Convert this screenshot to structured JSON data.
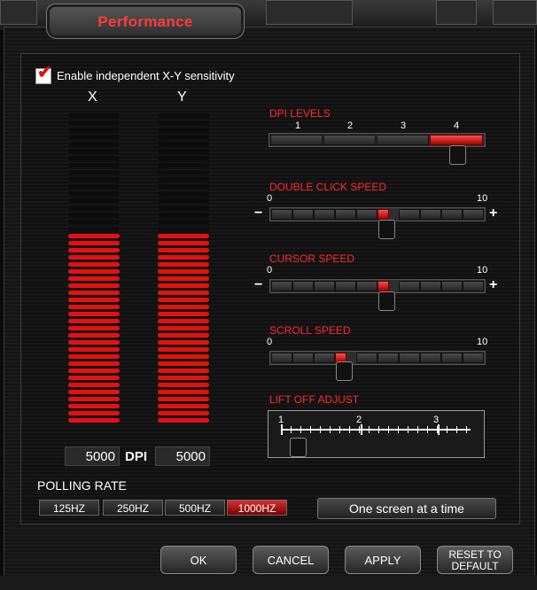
{
  "window": {
    "title": "Performance"
  },
  "xy": {
    "enable_label": "Enable independent X-Y sensitivity",
    "enabled": true,
    "x_label": "X",
    "y_label": "Y",
    "x_level": 0.62,
    "y_level": 0.62
  },
  "dpi": {
    "x_value": "5000",
    "label": "DPI",
    "y_value": "5000"
  },
  "dpi_levels": {
    "title": "DPI LEVELS",
    "labels": [
      "1",
      "2",
      "3",
      "4"
    ],
    "selected": "4"
  },
  "double_click": {
    "title": "DOUBLE CLICK SPEED",
    "min_label": "0",
    "max_label": "10",
    "minus": "−",
    "plus": "+",
    "value": 5
  },
  "cursor_speed": {
    "title": "CURSOR SPEED",
    "min_label": "0",
    "max_label": "10",
    "minus": "−",
    "plus": "+",
    "value": 5
  },
  "scroll_speed": {
    "title": "SCROLL SPEED",
    "min_label": "0",
    "max_label": "10",
    "value": 3
  },
  "lift_off": {
    "title": "LIFT OFF ADJUST",
    "labels": [
      "1",
      "2",
      "3"
    ],
    "value": 1.2
  },
  "polling": {
    "title": "POLLING RATE",
    "options": [
      "125HZ",
      "250HZ",
      "500HZ",
      "1000HZ"
    ],
    "selected": "1000HZ"
  },
  "scroll_mode": {
    "label": "One screen at a time"
  },
  "footer": {
    "ok": "OK",
    "cancel": "CANCEL",
    "apply": "APPLY",
    "reset_line1": "RESET TO",
    "reset_line2": "DEFAULT"
  },
  "colors": {
    "accent": "#e51010",
    "title": "#ff3b3b"
  },
  "icons": {
    "checkbox": "red-checkmark-icon",
    "slider_handle": "slider-handle-icon"
  }
}
